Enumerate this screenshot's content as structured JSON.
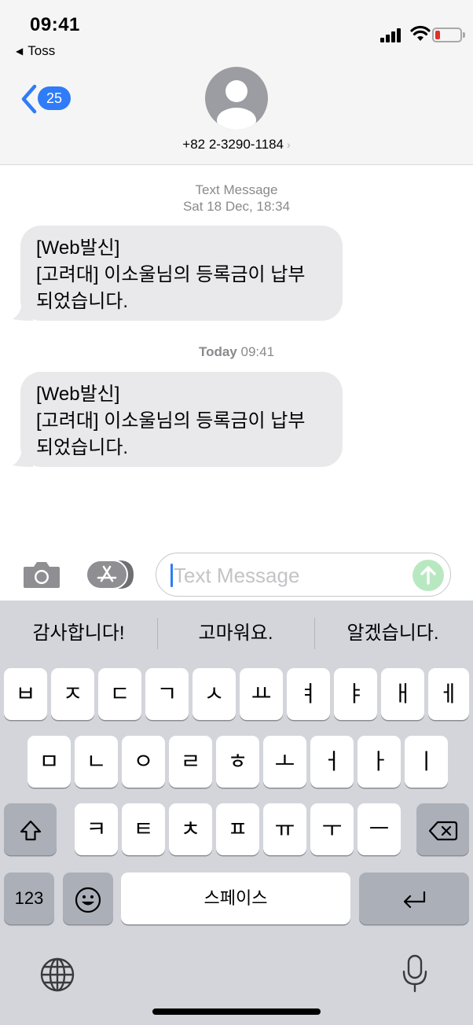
{
  "status_bar": {
    "time": "09:41",
    "back_app": "Toss"
  },
  "header": {
    "unread_count": "25",
    "contact": "+82 2-3290-1184",
    "contact_chevron": "›"
  },
  "thread": {
    "messages": [
      {
        "meta_label": "Text Message",
        "meta_time": "Sat 18 Dec, 18:34",
        "lines": [
          "[Web발신]",
          "[고려대] 이소울님의 등록금이 납부",
          "되었습니다."
        ]
      },
      {
        "meta_day": "Today",
        "meta_time": "09:41",
        "lines": [
          "[Web발신]",
          "[고려대] 이소울님의 등록금이 납부",
          "되었습니다."
        ]
      }
    ]
  },
  "compose": {
    "placeholder": "Text Message",
    "value": ""
  },
  "keyboard": {
    "suggestions": [
      "감사합니다!",
      "고마워요.",
      "알겠습니다."
    ],
    "row1": [
      "ㅂ",
      "ㅈ",
      "ㄷ",
      "ㄱ",
      "ㅅ",
      "ㅛ",
      "ㅕ",
      "ㅑ",
      "ㅐ",
      "ㅔ"
    ],
    "row2": [
      "ㅁ",
      "ㄴ",
      "ㅇ",
      "ㄹ",
      "ㅎ",
      "ㅗ",
      "ㅓ",
      "ㅏ",
      "ㅣ"
    ],
    "row3": [
      "ㅋ",
      "ㅌ",
      "ㅊ",
      "ㅍ",
      "ㅠ",
      "ㅜ",
      "ㅡ"
    ],
    "numbers_label": "123",
    "space_label": "스페이스"
  },
  "icons": {
    "location": "location-arrow-icon",
    "signal": "cellular-signal-icon",
    "wifi": "wifi-icon",
    "battery": "battery-low-icon",
    "back": "chevron-left-icon",
    "avatar": "person-silhouette-icon",
    "camera": "camera-icon",
    "apps": "app-store-icon",
    "send": "arrow-up-icon",
    "shift": "shift-icon",
    "delete": "delete-backspace-icon",
    "emoji": "emoji-smile-icon",
    "return": "return-arrow-icon",
    "globe": "globe-icon",
    "mic": "microphone-icon"
  },
  "colors": {
    "accent": "#2f7cf6",
    "bubble": "#e9e9eb",
    "send_disabled": "#b8e8c0",
    "battery_low": "#e0302a",
    "keyboard_bg": "#d3d5db"
  }
}
